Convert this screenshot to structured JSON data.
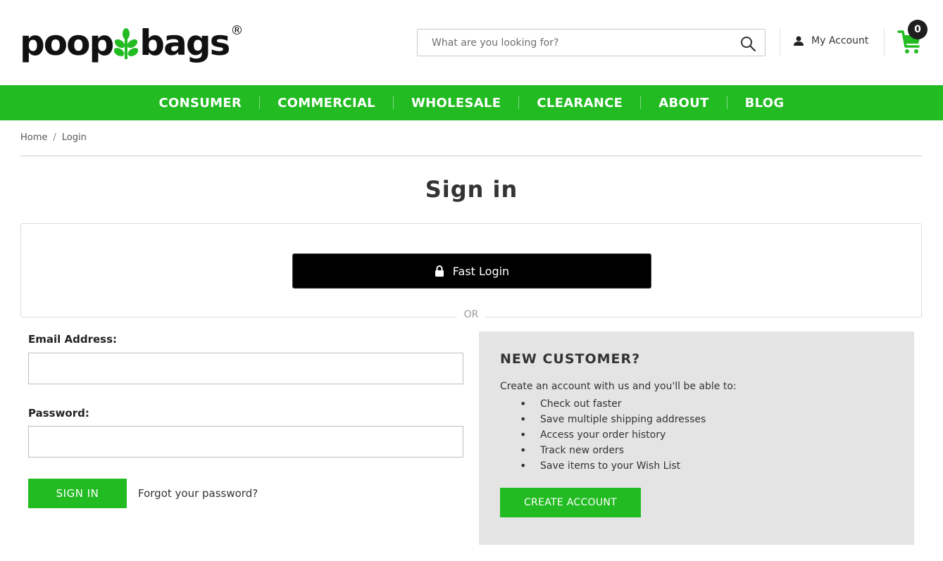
{
  "header": {
    "logo": {
      "part1": "poop",
      "part2": "bags",
      "reg": "®"
    },
    "search": {
      "placeholder": "What are you looking for?"
    },
    "account_label": "My Account",
    "cart_count": "0"
  },
  "nav": {
    "items": [
      {
        "label": "CONSUMER"
      },
      {
        "label": "COMMERCIAL"
      },
      {
        "label": "WHOLESALE"
      },
      {
        "label": "CLEARANCE"
      },
      {
        "label": "ABOUT"
      },
      {
        "label": "BLOG"
      }
    ]
  },
  "breadcrumb": {
    "home": "Home",
    "current": "Login",
    "sep": "/"
  },
  "page": {
    "title": "Sign in",
    "fast_login_label": "Fast Login",
    "or_label": "OR"
  },
  "form": {
    "email_label": "Email Address:",
    "email_value": "",
    "password_label": "Password:",
    "password_value": "",
    "signin_label": "SIGN IN",
    "forgot_label": "Forgot your password?"
  },
  "new_customer": {
    "heading": "NEW CUSTOMER?",
    "intro": "Create an account with us and you'll be able to:",
    "benefits": [
      "Check out faster",
      "Save multiple shipping addresses",
      "Access your order history",
      "Track new orders",
      "Save items to your Wish List"
    ],
    "create_label": "CREATE ACCOUNT"
  },
  "colors": {
    "brand_green": "#22bb22",
    "black": "#000000",
    "panel_gray": "#e4e4e4"
  },
  "icons": [
    "leaf-icon",
    "search-icon",
    "user-icon",
    "cart-icon",
    "lock-icon"
  ]
}
